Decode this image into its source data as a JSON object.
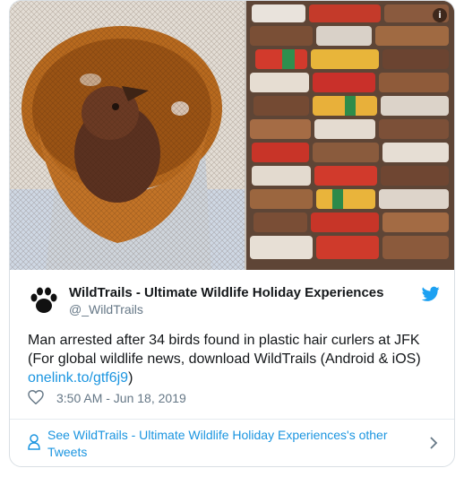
{
  "media": {
    "info_glyph": "i",
    "left_photo_icon": "bird-in-mesh-curler-photo",
    "right_photo_icon": "hair-curlers-photo"
  },
  "author": {
    "name": "WildTrails - Ultimate Wildlife Holiday Experiences",
    "handle": "@_WildTrails",
    "avatar_icon": "paw-icon"
  },
  "tweet": {
    "text": "Man arrested after 34 birds found in plastic hair curlers at JFK (For global wildlife news, download WildTrails (Android & iOS)",
    "link": "onelink.to/gtf6j9",
    "closing": ")"
  },
  "meta": {
    "timestamp": "3:50 AM - Jun 18, 2019",
    "like_icon": "heart-icon"
  },
  "more": {
    "label": "See WildTrails - Ultimate Wildlife Holiday Experiences's other Tweets"
  },
  "colors": {
    "link": "#1b95e0",
    "text": "#14171a",
    "muted": "#657786",
    "twitter_blue": "#1da1f2"
  }
}
